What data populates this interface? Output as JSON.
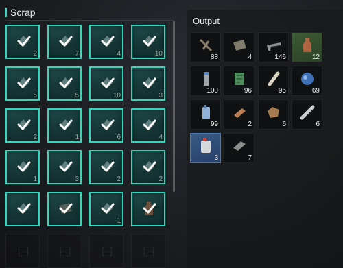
{
  "scrap": {
    "title": "Scrap",
    "slots": [
      {
        "qty": "2",
        "icon": "gear-part-icon"
      },
      {
        "qty": "7",
        "icon": "pipe-icon"
      },
      {
        "qty": "4",
        "icon": "blade-icon"
      },
      {
        "qty": "10",
        "icon": "circuit-icon"
      },
      {
        "qty": "5",
        "icon": "knife-icon"
      },
      {
        "qty": "5",
        "icon": "bag-icon"
      },
      {
        "qty": "10",
        "icon": "metal-sheet-icon"
      },
      {
        "qty": "3",
        "icon": "helmet-icon"
      },
      {
        "qty": "2",
        "icon": "fragment-icon"
      },
      {
        "qty": "1",
        "icon": "lamp-icon"
      },
      {
        "qty": "6",
        "icon": "frame-icon"
      },
      {
        "qty": "4",
        "icon": "scrap-icon"
      },
      {
        "qty": "1",
        "icon": "metal-plate-icon"
      },
      {
        "qty": "3",
        "icon": "debris-icon"
      },
      {
        "qty": "2",
        "icon": "rock-icon"
      },
      {
        "qty": "2",
        "icon": "armor-plate-icon"
      },
      {
        "qty": "",
        "icon": "hat-icon"
      },
      {
        "qty": "",
        "icon": "cloth-icon"
      },
      {
        "qty": "1",
        "icon": "cap-icon"
      },
      {
        "qty": "",
        "icon": "bottle-icon"
      }
    ]
  },
  "output": {
    "title": "Output",
    "items": [
      {
        "qty": "88",
        "icon": "nails-icon"
      },
      {
        "qty": "4",
        "icon": "cloth-icon"
      },
      {
        "qty": "146",
        "icon": "gun-part-icon"
      },
      {
        "qty": "12",
        "icon": "bottle-icon"
      },
      {
        "qty": "100",
        "icon": "battery-icon"
      },
      {
        "qty": "96",
        "icon": "circuit-board-icon"
      },
      {
        "qty": "95",
        "icon": "tube-icon"
      },
      {
        "qty": "69",
        "icon": "blue-crystals-icon"
      },
      {
        "qty": "99",
        "icon": "fuel-can-icon"
      },
      {
        "qty": "2",
        "icon": "copper-bar-icon"
      },
      {
        "qty": "6",
        "icon": "copper-scrap-icon"
      },
      {
        "qty": "6",
        "icon": "steel-rod-icon"
      },
      {
        "qty": "3",
        "icon": "jerrycan-icon"
      },
      {
        "qty": "7",
        "icon": "metal-ingot-icon"
      }
    ]
  },
  "colors": {
    "accent": "#33d6bc",
    "slot_fill": "#1a3c3c",
    "output_bg": "#101112",
    "selected_blue": "#2e4c78",
    "selected_green": "#35502e"
  }
}
